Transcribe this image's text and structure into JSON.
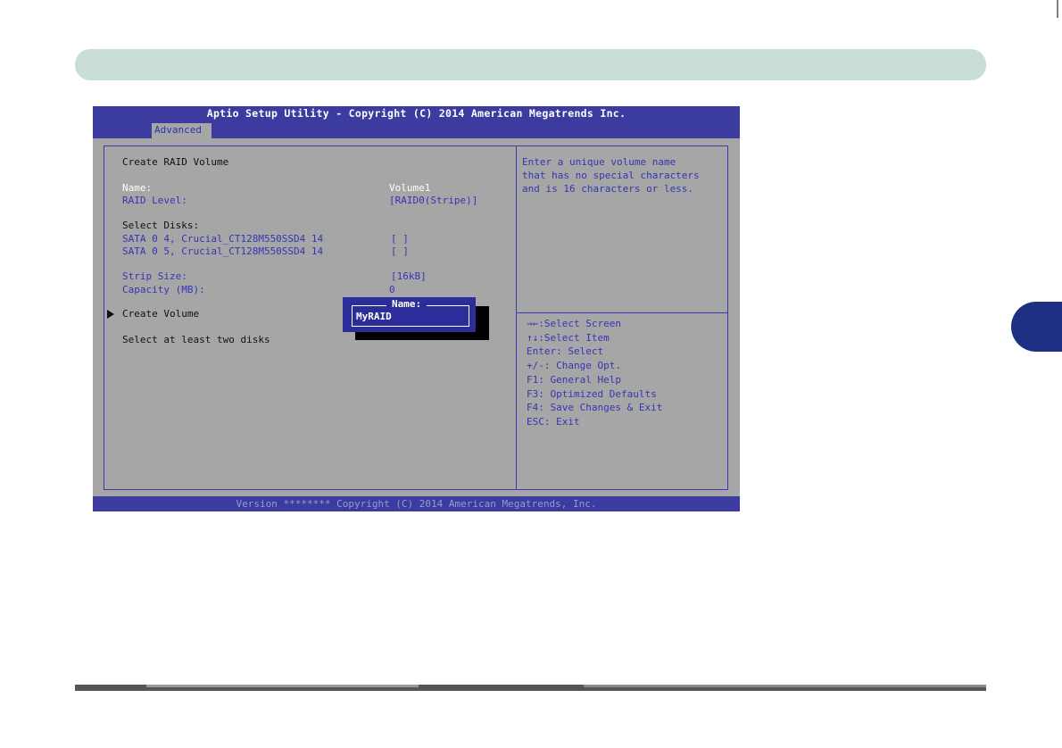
{
  "bios": {
    "title": "Aptio Setup Utility - Copyright (C) 2014 American Megatrends Inc.",
    "tab": "Advanced",
    "footer": "Version ******** Copyright (C) 2014 American Megatrends, Inc.",
    "section_title": "Create RAID Volume",
    "name_label": "Name:",
    "name_value": "Volume1",
    "raid_level_label": "RAID Level:",
    "raid_level_value": "[RAID0(Stripe)]",
    "select_disks_label": "Select Disks:",
    "disks": [
      {
        "label": "SATA 0 4, Crucial_CT128M550SSD4 14",
        "value": "[ ]"
      },
      {
        "label": "SATA 0 5, Crucial_CT128M550SSD4 14",
        "value": "[ ]"
      }
    ],
    "strip_size_label": "Strip Size:",
    "strip_size_value": "[16kB]",
    "capacity_label": "Capacity (MB):",
    "capacity_value": "0",
    "create_volume": "Create Volume",
    "select_note": "Select at least two disks",
    "help_text": [
      "Enter a unique volume name",
      "that has no special characters",
      "and is 16 characters or less."
    ],
    "keys": [
      "→←:Select Screen",
      "↑↓:Select Item",
      "Enter: Select",
      "+/-: Change Opt.",
      "F1: General Help",
      "F3: Optimized Defaults",
      "F4: Save Changes & Exit",
      "ESC: Exit"
    ],
    "popup": {
      "title": "Name:",
      "value": "MyRAID"
    }
  },
  "colors": {
    "header_blue": "#3b3ba0",
    "panel_gray": "#a6a6a6",
    "text_blue": "#3535b5",
    "banner_teal": "#c9ded9",
    "side_tab_navy": "#1d2f82"
  }
}
